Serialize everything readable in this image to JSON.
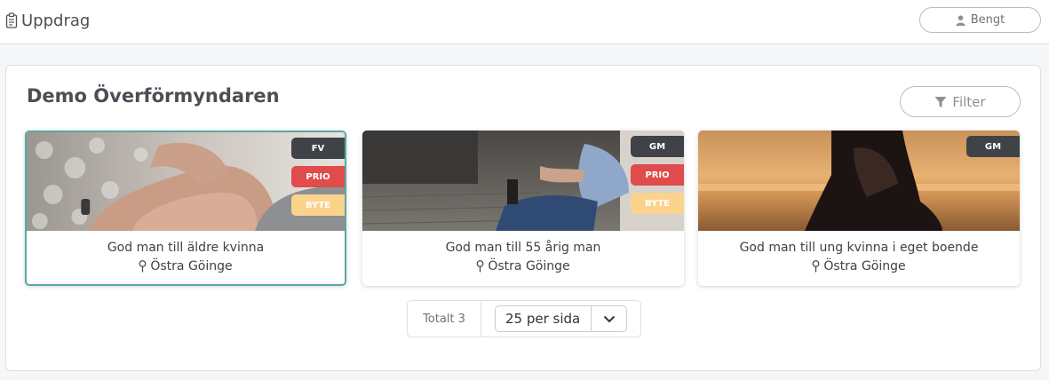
{
  "header": {
    "app_title": "Uppdrag",
    "app_icon": "clipboard-icon",
    "user_name": "Bengt",
    "user_icon": "user-icon"
  },
  "panel": {
    "title": "Demo Överförmyndaren",
    "filter_label": "Filter",
    "filter_icon": "funnel-icon"
  },
  "cards": [
    {
      "title": "God man till äldre kvinna",
      "location": "Östra Göinge",
      "selected": true,
      "badges": [
        {
          "label": "FV",
          "color": "#3f4347"
        },
        {
          "label": "PRIO",
          "color": "#e04b4b"
        },
        {
          "label": "BYTE",
          "color": "#fbd38d"
        }
      ]
    },
    {
      "title": "God man till 55 årig man",
      "location": "Östra Göinge",
      "selected": false,
      "badges": [
        {
          "label": "GM",
          "color": "#3f4347"
        },
        {
          "label": "PRIO",
          "color": "#e04b4b"
        },
        {
          "label": "BYTE",
          "color": "#fbd38d"
        }
      ]
    },
    {
      "title": "God man till ung kvinna i eget boende",
      "location": "Östra Göinge",
      "selected": false,
      "badges": [
        {
          "label": "GM",
          "color": "#3f4347"
        }
      ]
    }
  ],
  "pagination": {
    "total_label": "Totalt 3",
    "per_page_value": "25 per sida"
  },
  "colors": {
    "accent": "#5aa9a2",
    "dark_badge": "#3f4347",
    "prio_badge": "#e04b4b",
    "byte_badge": "#fbd38d"
  }
}
